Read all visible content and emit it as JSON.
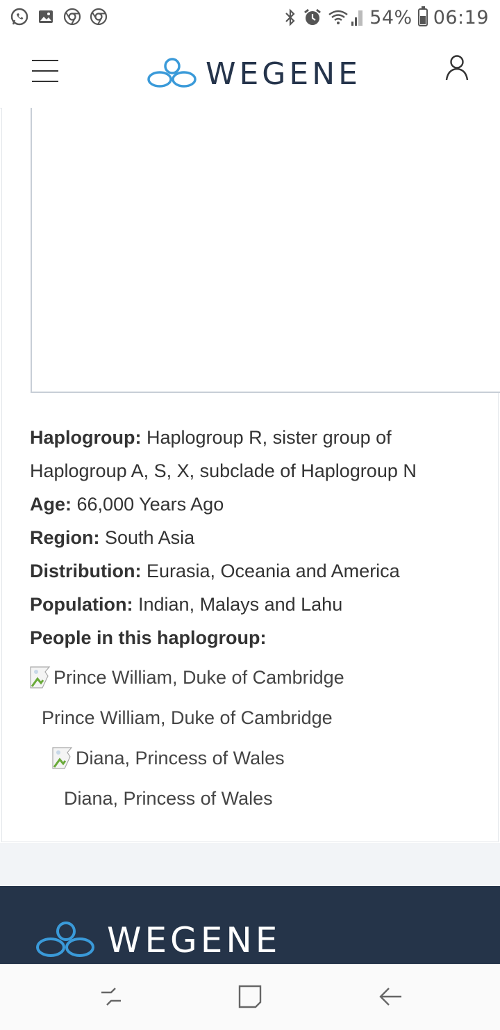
{
  "status_bar": {
    "left_icons": [
      "whatsapp-icon",
      "gallery-icon",
      "chrome-icon",
      "chrome-icon"
    ],
    "battery": "54%",
    "time": "06:19",
    "battery_level": 0.54
  },
  "header": {
    "brand": "WEGENE",
    "menu_icon": "hamburger-menu-icon",
    "user_icon": "user-icon"
  },
  "info": {
    "haplogroup_label": "Haplogroup:",
    "haplogroup_value": "Haplogroup R, sister group of Haplogroup A, S, X, subclade of Haplogroup N",
    "age_label": "Age:",
    "age_value": "66,000 Years Ago",
    "region_label": "Region:",
    "region_value": "South Asia",
    "distribution_label": "Distribution:",
    "distribution_value": "Eurasia, Oceania and America",
    "population_label": "Population:",
    "population_value": "Indian, Malays and Lahu",
    "people_label": "People in this haplogroup:"
  },
  "people": [
    {
      "image_alt": "Prince William, Duke of Cambridge",
      "caption": "Prince William, Duke of Cambridge"
    },
    {
      "image_alt": "Diana, Princess of Wales",
      "caption": "Diana, Princess of Wales"
    }
  ],
  "footer": {
    "brand": "WEGENE"
  },
  "colors": {
    "brand_blue": "#3a9ad9",
    "brand_dark": "#25344b",
    "footer_bg": "#253449"
  }
}
